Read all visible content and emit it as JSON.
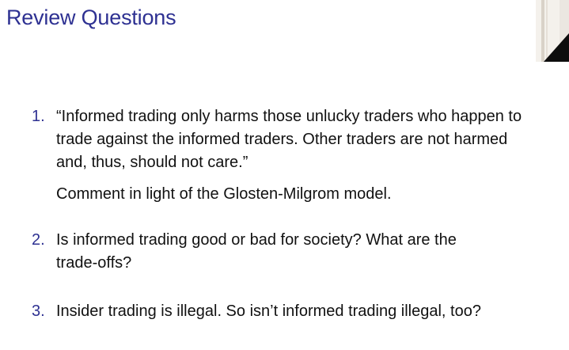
{
  "slide": {
    "title": "Review Questions",
    "title_color": "#2e3192"
  },
  "questions": [
    {
      "number": "1.",
      "lines": [
        "“Informed trading only harms those unlucky traders who happen to",
        "trade against the informed traders. Other traders are not harmed",
        "and, thus, should not care.”"
      ],
      "note": "Comment in light of the Glosten-Milgrom model."
    },
    {
      "number": "2.",
      "lines": [
        "Is informed trading good or bad for society? What are the",
        "trade-offs?"
      ]
    },
    {
      "number": "3.",
      "lines": [
        "Insider trading is illegal. So isn’t informed trading illegal, too?"
      ]
    }
  ]
}
